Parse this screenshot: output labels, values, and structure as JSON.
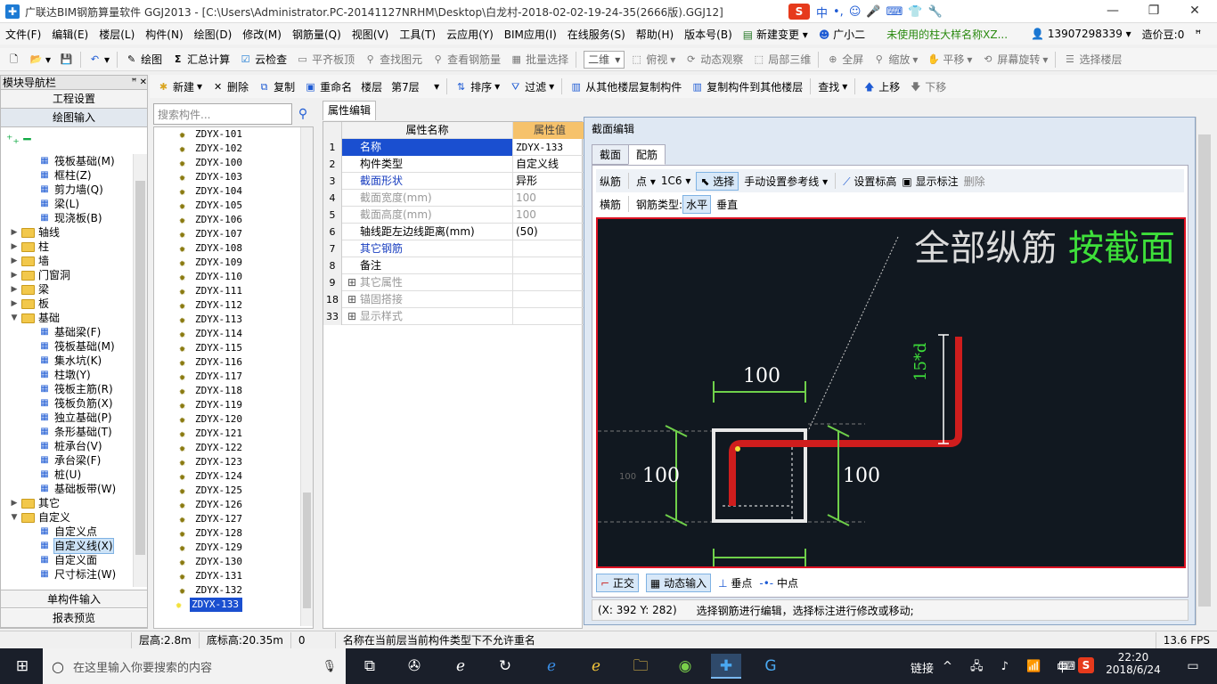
{
  "window": {
    "title": "广联达BIM钢筋算量软件 GGJ2013 - [C:\\Users\\Administrator.PC-20141127NRHM\\Desktop\\白龙村-2018-02-02-19-24-35(2666版).GGJ12]",
    "ime_items": [
      "中",
      "•,",
      "☺",
      "🎤",
      "⌨",
      "👕",
      "🔧"
    ]
  },
  "menu": [
    "文件(F)",
    "编辑(E)",
    "楼层(L)",
    "构件(N)",
    "绘图(D)",
    "修改(M)",
    "钢筋量(Q)",
    "视图(V)",
    "工具(T)",
    "云应用(Y)",
    "BIM应用(I)",
    "在线服务(S)",
    "帮助(H)",
    "版本号(B)",
    "新建变更",
    "广小二",
    "未使用的柱大样名称XZ...",
    "13907298339",
    "造价豆:0"
  ],
  "toolbar1": {
    "draw": "绘图",
    "sum": "汇总计算",
    "cloud_check": "云检查",
    "align_top": "平齐板顶",
    "find_elem": "查找图元",
    "view_rebar": "查看钢筋量",
    "batch_select": "批量选择",
    "view_mode": "二维",
    "top_view": "俯视",
    "dynamic": "动态观察",
    "local3d": "局部三维",
    "fullscreen": "全屏",
    "zoom": "缩放",
    "pan": "平移",
    "rotate": "屏幕旋转",
    "select_floor": "选择楼层"
  },
  "toolbar2": {
    "new": "新建",
    "delete": "删除",
    "copy": "复制",
    "rename": "重命名",
    "floor_label": "楼层",
    "floor_value": "第7层",
    "sort": "排序",
    "filter": "过滤",
    "copy_from": "从其他楼层复制构件",
    "copy_to": "复制构件到其他楼层",
    "find": "查找",
    "up": "上移",
    "down": "下移"
  },
  "nav": {
    "header": "模块导航栏",
    "pin": "ꟸ ✕",
    "btn_project": "工程设置",
    "btn_draw": "绘图输入",
    "btn_single": "单构件输入",
    "btn_report": "报表预览",
    "tree": [
      {
        "label": "筏板基础(M)",
        "indent": 2,
        "kind": "item"
      },
      {
        "label": "框柱(Z)",
        "indent": 2,
        "kind": "item"
      },
      {
        "label": "剪力墙(Q)",
        "indent": 2,
        "kind": "item"
      },
      {
        "label": "梁(L)",
        "indent": 2,
        "kind": "item"
      },
      {
        "label": "现浇板(B)",
        "indent": 2,
        "kind": "item"
      },
      {
        "label": "轴线",
        "indent": 0,
        "kind": "folder"
      },
      {
        "label": "柱",
        "indent": 0,
        "kind": "folder"
      },
      {
        "label": "墙",
        "indent": 0,
        "kind": "folder"
      },
      {
        "label": "门窗洞",
        "indent": 0,
        "kind": "folder"
      },
      {
        "label": "梁",
        "indent": 0,
        "kind": "folder"
      },
      {
        "label": "板",
        "indent": 0,
        "kind": "folder"
      },
      {
        "label": "基础",
        "indent": 0,
        "kind": "folder-open"
      },
      {
        "label": "基础梁(F)",
        "indent": 2,
        "kind": "item"
      },
      {
        "label": "筏板基础(M)",
        "indent": 2,
        "kind": "item"
      },
      {
        "label": "集水坑(K)",
        "indent": 2,
        "kind": "item"
      },
      {
        "label": "柱墩(Y)",
        "indent": 2,
        "kind": "item"
      },
      {
        "label": "筏板主筋(R)",
        "indent": 2,
        "kind": "item"
      },
      {
        "label": "筏板负筋(X)",
        "indent": 2,
        "kind": "item"
      },
      {
        "label": "独立基础(P)",
        "indent": 2,
        "kind": "item"
      },
      {
        "label": "条形基础(T)",
        "indent": 2,
        "kind": "item"
      },
      {
        "label": "桩承台(V)",
        "indent": 2,
        "kind": "item"
      },
      {
        "label": "承台梁(F)",
        "indent": 2,
        "kind": "item"
      },
      {
        "label": "桩(U)",
        "indent": 2,
        "kind": "item"
      },
      {
        "label": "基础板带(W)",
        "indent": 2,
        "kind": "item"
      },
      {
        "label": "其它",
        "indent": 0,
        "kind": "folder"
      },
      {
        "label": "自定义",
        "indent": 0,
        "kind": "folder-open"
      },
      {
        "label": "自定义点",
        "indent": 2,
        "kind": "item"
      },
      {
        "label": "自定义线(X)",
        "indent": 2,
        "kind": "item",
        "selected": true
      },
      {
        "label": "自定义面",
        "indent": 2,
        "kind": "item"
      },
      {
        "label": "尺寸标注(W)",
        "indent": 2,
        "kind": "item"
      }
    ]
  },
  "list": {
    "search_placeholder": "搜索构件...",
    "items": [
      "ZDYX-101",
      "ZDYX-102",
      "ZDYX-100",
      "ZDYX-103",
      "ZDYX-104",
      "ZDYX-105",
      "ZDYX-106",
      "ZDYX-107",
      "ZDYX-108",
      "ZDYX-109",
      "ZDYX-110",
      "ZDYX-111",
      "ZDYX-112",
      "ZDYX-113",
      "ZDYX-114",
      "ZDYX-115",
      "ZDYX-116",
      "ZDYX-117",
      "ZDYX-118",
      "ZDYX-119",
      "ZDYX-120",
      "ZDYX-121",
      "ZDYX-122",
      "ZDYX-123",
      "ZDYX-124",
      "ZDYX-125",
      "ZDYX-126",
      "ZDYX-127",
      "ZDYX-128",
      "ZDYX-129",
      "ZDYX-130",
      "ZDYX-131",
      "ZDYX-132",
      "ZDYX-133"
    ],
    "selected": "ZDYX-133"
  },
  "props": {
    "tab": "属性编辑",
    "col_name": "属性名称",
    "col_value": "属性值",
    "rows": [
      {
        "num": "1",
        "name": "名称",
        "value": "ZDYX-133",
        "style": "blue",
        "selected": true
      },
      {
        "num": "2",
        "name": "构件类型",
        "value": "自定义线",
        "style": ""
      },
      {
        "num": "3",
        "name": "截面形状",
        "value": "异形",
        "style": "blue"
      },
      {
        "num": "4",
        "name": "截面宽度(mm)",
        "value": "100",
        "style": "gray"
      },
      {
        "num": "5",
        "name": "截面高度(mm)",
        "value": "100",
        "style": "gray"
      },
      {
        "num": "6",
        "name": "轴线距左边线距离(mm)",
        "value": "(50)",
        "style": ""
      },
      {
        "num": "7",
        "name": "其它钢筋",
        "value": "",
        "style": "blue"
      },
      {
        "num": "8",
        "name": "备注",
        "value": "",
        "style": ""
      },
      {
        "num": "9",
        "name": "其它属性",
        "value": "",
        "style": "gray",
        "expand": true
      },
      {
        "num": "18",
        "name": "锚固搭接",
        "value": "",
        "style": "gray",
        "expand": true
      },
      {
        "num": "33",
        "name": "显示样式",
        "value": "",
        "style": "gray",
        "expand": true
      }
    ]
  },
  "dialog": {
    "title": "截面编辑",
    "tab_section": "截面",
    "tab_rebar": "配筋",
    "long_rebar": "纵筋",
    "point": "点",
    "rebar_spec": "1C6",
    "select": "选择",
    "manual_ref": "手动设置参考线",
    "set_elev": "设置标高",
    "show_label": "显示标注",
    "remove": "删除",
    "horiz_rebar": "横筋",
    "rebar_type_label": "钢筋类型:",
    "horizontal": "水平",
    "vertical": "垂直",
    "canvas_text_white": "全部纵筋",
    "canvas_text_green": "按截面",
    "dim_top": "100",
    "dim_left": "100",
    "dim_right": "100",
    "dim_small": "100",
    "dim_vert": "15*d",
    "ortho": "正交",
    "dyn_input": "动态输入",
    "perp": "垂点",
    "midpoint": "中点",
    "coords": "(X: 392 Y: 282)",
    "hint": "选择钢筋进行编辑，选择标注进行修改或移动;"
  },
  "statusbar": {
    "floor_height": "层高:2.8m",
    "bottom_elev": "底标高:20.35m",
    "zero": "0",
    "message": "名称在当前层当前构件类型下不允许重名",
    "fps": "13.6 FPS"
  },
  "taskbar": {
    "search_placeholder": "在这里输入你要搜索的内容",
    "link": "链接",
    "lang": "中",
    "time": "22:20",
    "date": "2018/6/24"
  }
}
